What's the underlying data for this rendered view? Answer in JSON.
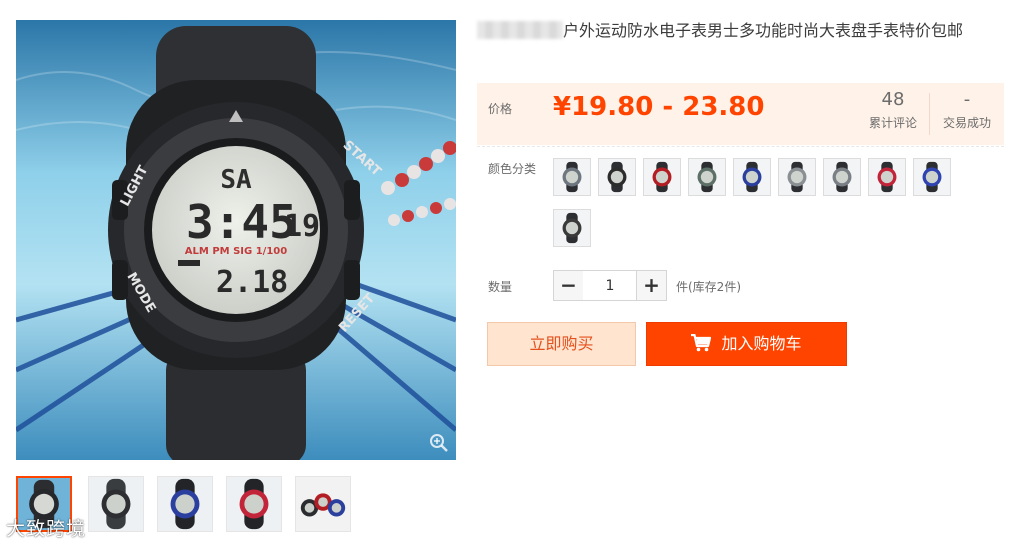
{
  "product": {
    "title": "户外运动防水电子表男士多功能时尚大表盘手表特价包邮"
  },
  "watch_face": {
    "brand_ring": {
      "light": "LIGHT",
      "start": "START",
      "mode": "MODE",
      "reset": "RESET"
    },
    "day": "SA",
    "time": "3:45",
    "seconds": "19",
    "indicators": "ALM  PM  SIG  1/100",
    "date": "2.18"
  },
  "price": {
    "label": "价格",
    "value": "¥19.80 - 23.80"
  },
  "stats": {
    "reviews_count": "48",
    "reviews_label": "累计评论",
    "sales_count": "-",
    "sales_label": "交易成功"
  },
  "colors": {
    "label": "颜色分类",
    "swatches": [
      {
        "name": "black-grey",
        "accent": "#6e7680"
      },
      {
        "name": "black",
        "accent": "#2c2c2c"
      },
      {
        "name": "red",
        "accent": "#b21e24"
      },
      {
        "name": "green-grey",
        "accent": "#5c7067"
      },
      {
        "name": "blue-band",
        "accent": "#2a3f9e"
      },
      {
        "name": "white-face",
        "accent": "#8a8f94"
      },
      {
        "name": "grey-small",
        "accent": "#7a7f86"
      },
      {
        "name": "red-face",
        "accent": "#c2253a"
      },
      {
        "name": "blue-face",
        "accent": "#2f44b0"
      },
      {
        "name": "black-large",
        "accent": "#3a3a3a"
      }
    ]
  },
  "quantity": {
    "label": "数量",
    "minus": "−",
    "plus": "+",
    "value": "1",
    "unit": "件(库存2件)"
  },
  "actions": {
    "buy_now": "立即购买",
    "add_to_cart": "加入购物车"
  },
  "gallery": {
    "thumbnails": [
      {
        "name": "swim-pool",
        "accent": "#3b8fc4"
      },
      {
        "name": "grey-watch",
        "accent": "#7a7f86"
      },
      {
        "name": "blue-watch",
        "accent": "#2a3f9e"
      },
      {
        "name": "red-watch",
        "accent": "#c2253a"
      },
      {
        "name": "three-watches",
        "accent": "#b21e24"
      }
    ]
  },
  "watermark": "大致跨境",
  "colors_theme": {
    "accent": "#ff4400",
    "price_bg": "#fff2e8",
    "buy_now_bg": "#ffe4d0"
  }
}
